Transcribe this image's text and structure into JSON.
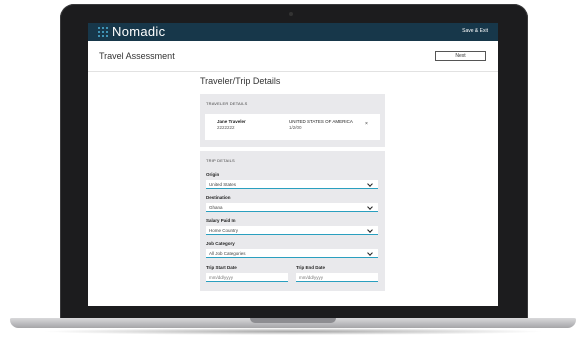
{
  "app": {
    "brand": "Nomadic",
    "save_exit": "Save & Exit",
    "page_title": "Travel Assessment",
    "next_label": "Next"
  },
  "form": {
    "section_title": "Traveler/Trip Details",
    "traveler": {
      "heading": "TRAVELER DETAILS",
      "name": "Jane Traveler",
      "id": "2222222",
      "country": "UNITED STATES OF AMERICA",
      "dob": "1/2/00",
      "remove_symbol": "×"
    },
    "trip": {
      "heading": "TRIP DETAILS",
      "origin_label": "Origin",
      "origin_value": "United States",
      "destination_label": "Destination",
      "destination_value": "Ghana",
      "salary_label": "Salary Paid In",
      "salary_value": "Home Country",
      "category_label": "Job Category",
      "category_value": "All Job Categories",
      "start_label": "Trip Start Date",
      "start_placeholder": "mm/dd/yyyy",
      "end_label": "Trip End Date",
      "end_placeholder": "mm/dd/yyyy"
    }
  },
  "colors": {
    "topbar": "#17374a",
    "accent": "#2a9fbf",
    "card_bg": "#e9e9ec"
  },
  "icons": {
    "brand": "nomadic-logo-icon",
    "dropdown": "chevron-down-icon",
    "remove": "close-icon"
  }
}
